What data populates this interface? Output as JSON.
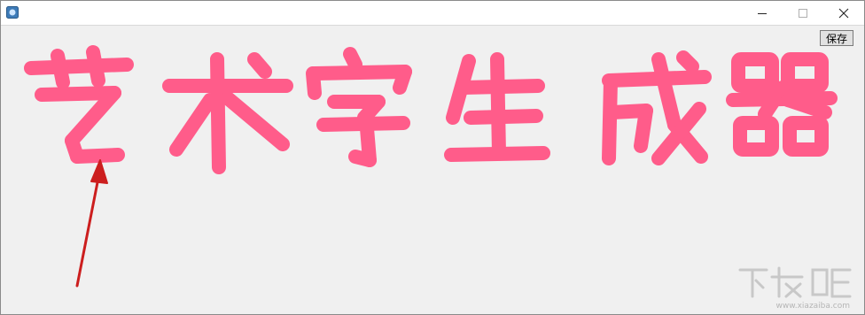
{
  "window": {
    "controls": {
      "minimize_glyph": "—",
      "maximize_glyph": "☐",
      "close_glyph": "✕"
    },
    "icon": "app-window-icon"
  },
  "toolbar": {
    "save_label": "保存"
  },
  "artwork": {
    "text": "艺术字生成器",
    "color": "#ff5c8a"
  },
  "annotation": {
    "arrow_color": "#cc1e1e"
  },
  "watermark": {
    "logo_text": "下载吧",
    "url_text": "www.xiazaiba.com"
  },
  "colors": {
    "window_bg": "#f0f0f0",
    "titlebar_bg": "#ffffff",
    "art_pink": "#ff5c8a",
    "arrow_red": "#cc1e1e"
  }
}
